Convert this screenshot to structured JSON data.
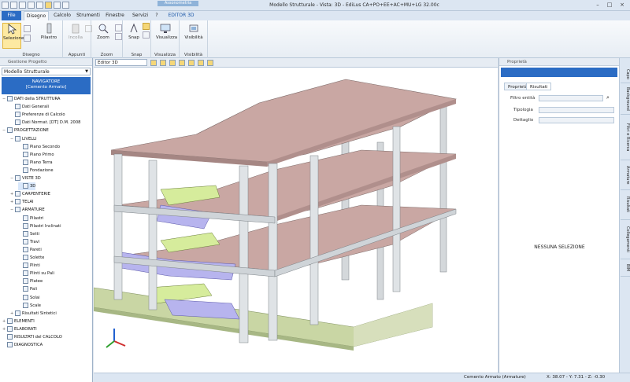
{
  "titlebar": {
    "title": "Modello Strutturale - Vista: 3D - EdiLus CA+PO+EE+AC+MU+LG 32.00c",
    "context_tab": "Assonometria"
  },
  "tabs": [
    "File",
    "Disegno",
    "Calcolo",
    "Strumenti",
    "Finestre",
    "Servizi",
    "?",
    "EDITOR 3D"
  ],
  "ribbon": {
    "groups": [
      {
        "label": "Disegno",
        "buttons": [
          "Selezione",
          "Pilastro"
        ]
      },
      {
        "label": "Appunti",
        "buttons": [
          "Incolla"
        ]
      },
      {
        "label": "Zoom",
        "buttons": [
          "Zoom"
        ]
      },
      {
        "label": "Snap",
        "buttons": [
          "Snap"
        ]
      },
      {
        "label": "Visualizza",
        "buttons": [
          "Visualizza"
        ]
      },
      {
        "label": "Visibilità",
        "buttons": [
          "Visibilità"
        ]
      }
    ]
  },
  "left_panel": {
    "header": "Gestione Progetto",
    "model_select": "Modello Strutturale",
    "navigator": [
      "NAVIGATORE",
      "[Cemento Armato]"
    ],
    "tree": [
      {
        "label": "DATI della STRUTTURA",
        "level": 0,
        "exp": "−"
      },
      {
        "label": "Dati Generali",
        "level": 1,
        "exp": ""
      },
      {
        "label": "Preferenze di Calcolo",
        "level": 1,
        "exp": ""
      },
      {
        "label": "Dati Normat. [DT] D.M. 2008",
        "level": 1,
        "exp": ""
      },
      {
        "label": "PROGETTAZIONE",
        "level": 0,
        "exp": "−"
      },
      {
        "label": "LIVELLI",
        "level": 1,
        "exp": "−"
      },
      {
        "label": "Piano Secondo",
        "level": 2,
        "exp": ""
      },
      {
        "label": "Piano Primo",
        "level": 2,
        "exp": ""
      },
      {
        "label": "Piano Terra",
        "level": 2,
        "exp": ""
      },
      {
        "label": "Fondazione",
        "level": 2,
        "exp": ""
      },
      {
        "label": "VISTE 3D",
        "level": 1,
        "exp": "−"
      },
      {
        "label": "3D",
        "level": 2,
        "exp": "",
        "selected": true
      },
      {
        "label": "CARPENTERIE",
        "level": 1,
        "exp": "+"
      },
      {
        "label": "TELAI",
        "level": 1,
        "exp": "+"
      },
      {
        "label": "ARMATURE",
        "level": 1,
        "exp": "−"
      },
      {
        "label": "Pilastri",
        "level": 2,
        "exp": ""
      },
      {
        "label": "Pilastri Inclinati",
        "level": 2,
        "exp": ""
      },
      {
        "label": "Setti",
        "level": 2,
        "exp": ""
      },
      {
        "label": "Travi",
        "level": 2,
        "exp": ""
      },
      {
        "label": "Pareti",
        "level": 2,
        "exp": ""
      },
      {
        "label": "Solette",
        "level": 2,
        "exp": ""
      },
      {
        "label": "Plinti",
        "level": 2,
        "exp": ""
      },
      {
        "label": "Plinti su Pali",
        "level": 2,
        "exp": ""
      },
      {
        "label": "Platee",
        "level": 2,
        "exp": ""
      },
      {
        "label": "Pali",
        "level": 2,
        "exp": ""
      },
      {
        "label": "Solai",
        "level": 2,
        "exp": ""
      },
      {
        "label": "Scale",
        "level": 2,
        "exp": ""
      },
      {
        "label": "Risultati Sintetici",
        "level": 1,
        "exp": "+"
      },
      {
        "label": "ELEMENTI",
        "level": 0,
        "exp": "+"
      },
      {
        "label": "ELABORATI",
        "level": 0,
        "exp": "+"
      },
      {
        "label": "RISULTATI del CALCOLO",
        "level": 0,
        "exp": ""
      },
      {
        "label": "DIAGNOSTICA",
        "level": 0,
        "exp": ""
      }
    ]
  },
  "view": {
    "selector": "Editor 3D"
  },
  "right_panel": {
    "header": "Proprietà",
    "tabs": [
      "Proprietà",
      "Risultati"
    ],
    "filter_label": "Filtro entità",
    "tipologia_label": "Tipologia",
    "dettaglio_label": "Dettaglio",
    "empty_text": "NESSUNA SELEZIONE"
  },
  "side_tabs": [
    "Capo",
    "Background",
    "Filtri e Ricerca",
    "Armature",
    "Risultati",
    "Collegamenti",
    "BIM"
  ],
  "status": {
    "mode": "Cemento Armato (Armature)",
    "coords": "X: 38.07 - Y: 7.31 - Z: -0.30"
  },
  "colors": {
    "accent": "#2b6cc4",
    "slab_top": "#c9a7a3",
    "column": "#d4d8db",
    "stairs": "#b7b4ee",
    "landing": "#d6ec9c",
    "ground": "#c9d6a4"
  }
}
